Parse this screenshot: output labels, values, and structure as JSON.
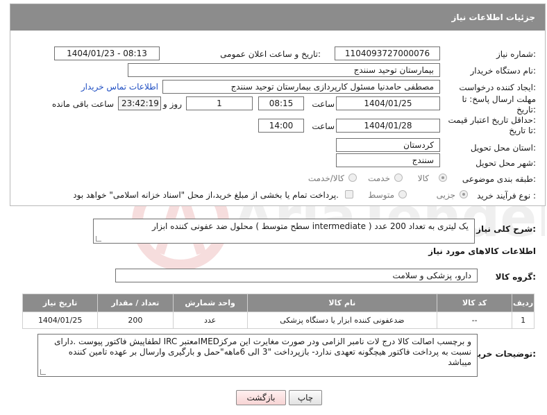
{
  "header": {
    "title": "جزئیات اطلاعات نیاز"
  },
  "form": {
    "need_number_label": "شماره نیاز:",
    "need_number": "1104093727000076",
    "announce_label": "تاریخ و ساعت اعلان عمومی:",
    "announce_value": "1404/01/23 - 08:13",
    "buyer_org_label": "نام دستگاه خریدار:",
    "buyer_org": "بیمارستان توحید سنندج",
    "creator_label": "ایجاد کننده درخواست:",
    "creator": "مصطفی حامدنیا مسئول کارپردازی بیمارستان توحید سنندج",
    "contact_link": "اطلاعات تماس خریدار",
    "deadline_label_1": "مهلت ارسال پاسخ: تا",
    "deadline_label_2": "تاریخ:",
    "deadline_date": "1404/01/25",
    "time_word": "ساعت",
    "deadline_time": "08:15",
    "days_value": "1",
    "days_word": "روز و",
    "remaining_time": "23:42:19",
    "remaining_word": "ساعت باقی مانده",
    "validity_label_1": "حداقل تاریخ اعتبار قیمت:",
    "validity_label_2": "تا تاریخ:",
    "validity_date": "1404/01/28",
    "validity_time": "14:00",
    "province_label": "استان محل تحویل:",
    "province": "کردستان",
    "city_label": "شهر محل تحویل:",
    "city": "سنندج",
    "category_label": "طبقه بندی موضوعی:",
    "category_options": [
      "کالا",
      "خدمت",
      "کالا/خدمت"
    ],
    "process_label": "نوع فرآیند خرید :",
    "process_options": [
      "جزیی",
      "متوسط"
    ],
    "payment_note": "پرداخت تمام یا بخشی از مبلغ خرید،از محل \"اسناد خزانه اسلامی\" خواهد بود."
  },
  "summary": {
    "label": "شرح کلی نیاز:",
    "text": "محلول ضد عفونی کننده ابزار ( سطح متوسط intermediate ) یک لیتری به تعداد 200 عدد"
  },
  "goods": {
    "section_title": "اطلاعات کالاهای مورد نیاز",
    "group_label": "گروه کالا:",
    "group_value": "دارو، پزشکی و سلامت",
    "columns": [
      "ردیف",
      "کد کالا",
      "نام کالا",
      "واحد شمارش",
      "تعداد / مقدار",
      "تاریخ نیاز"
    ],
    "rows": [
      {
        "row": "1",
        "code": "--",
        "name": "ضدعفونی کننده ابزار یا دستگاه پزشکی",
        "unit": "عدد",
        "qty": "200",
        "date": "1404/01/25"
      }
    ]
  },
  "buyer_notes": {
    "label": "توضیحات خریدار:",
    "text": "لطفاپیش فاکتور پیوست .دارای IRC معتبرIMEDو برچسب اصالت کالا درج لات نامبر الزامی ودر صورت مغایرت این مرکز نسبت به پرداخت فاکتور هیچگونه تعهدی ندارد- بازپرداخت \"3 الی 6ماهه\"حمل و بارگیری وارسال بر عهده تامین کننده میباشد"
  },
  "buttons": {
    "print": "چاپ",
    "back": "بازگشت"
  },
  "colors": {
    "header_bg": "#8c8c8c",
    "link": "#1f4ec2",
    "back_button_bg": "#f7d4d4"
  },
  "icons": {
    "watermark": "aria-tender-watermark"
  }
}
